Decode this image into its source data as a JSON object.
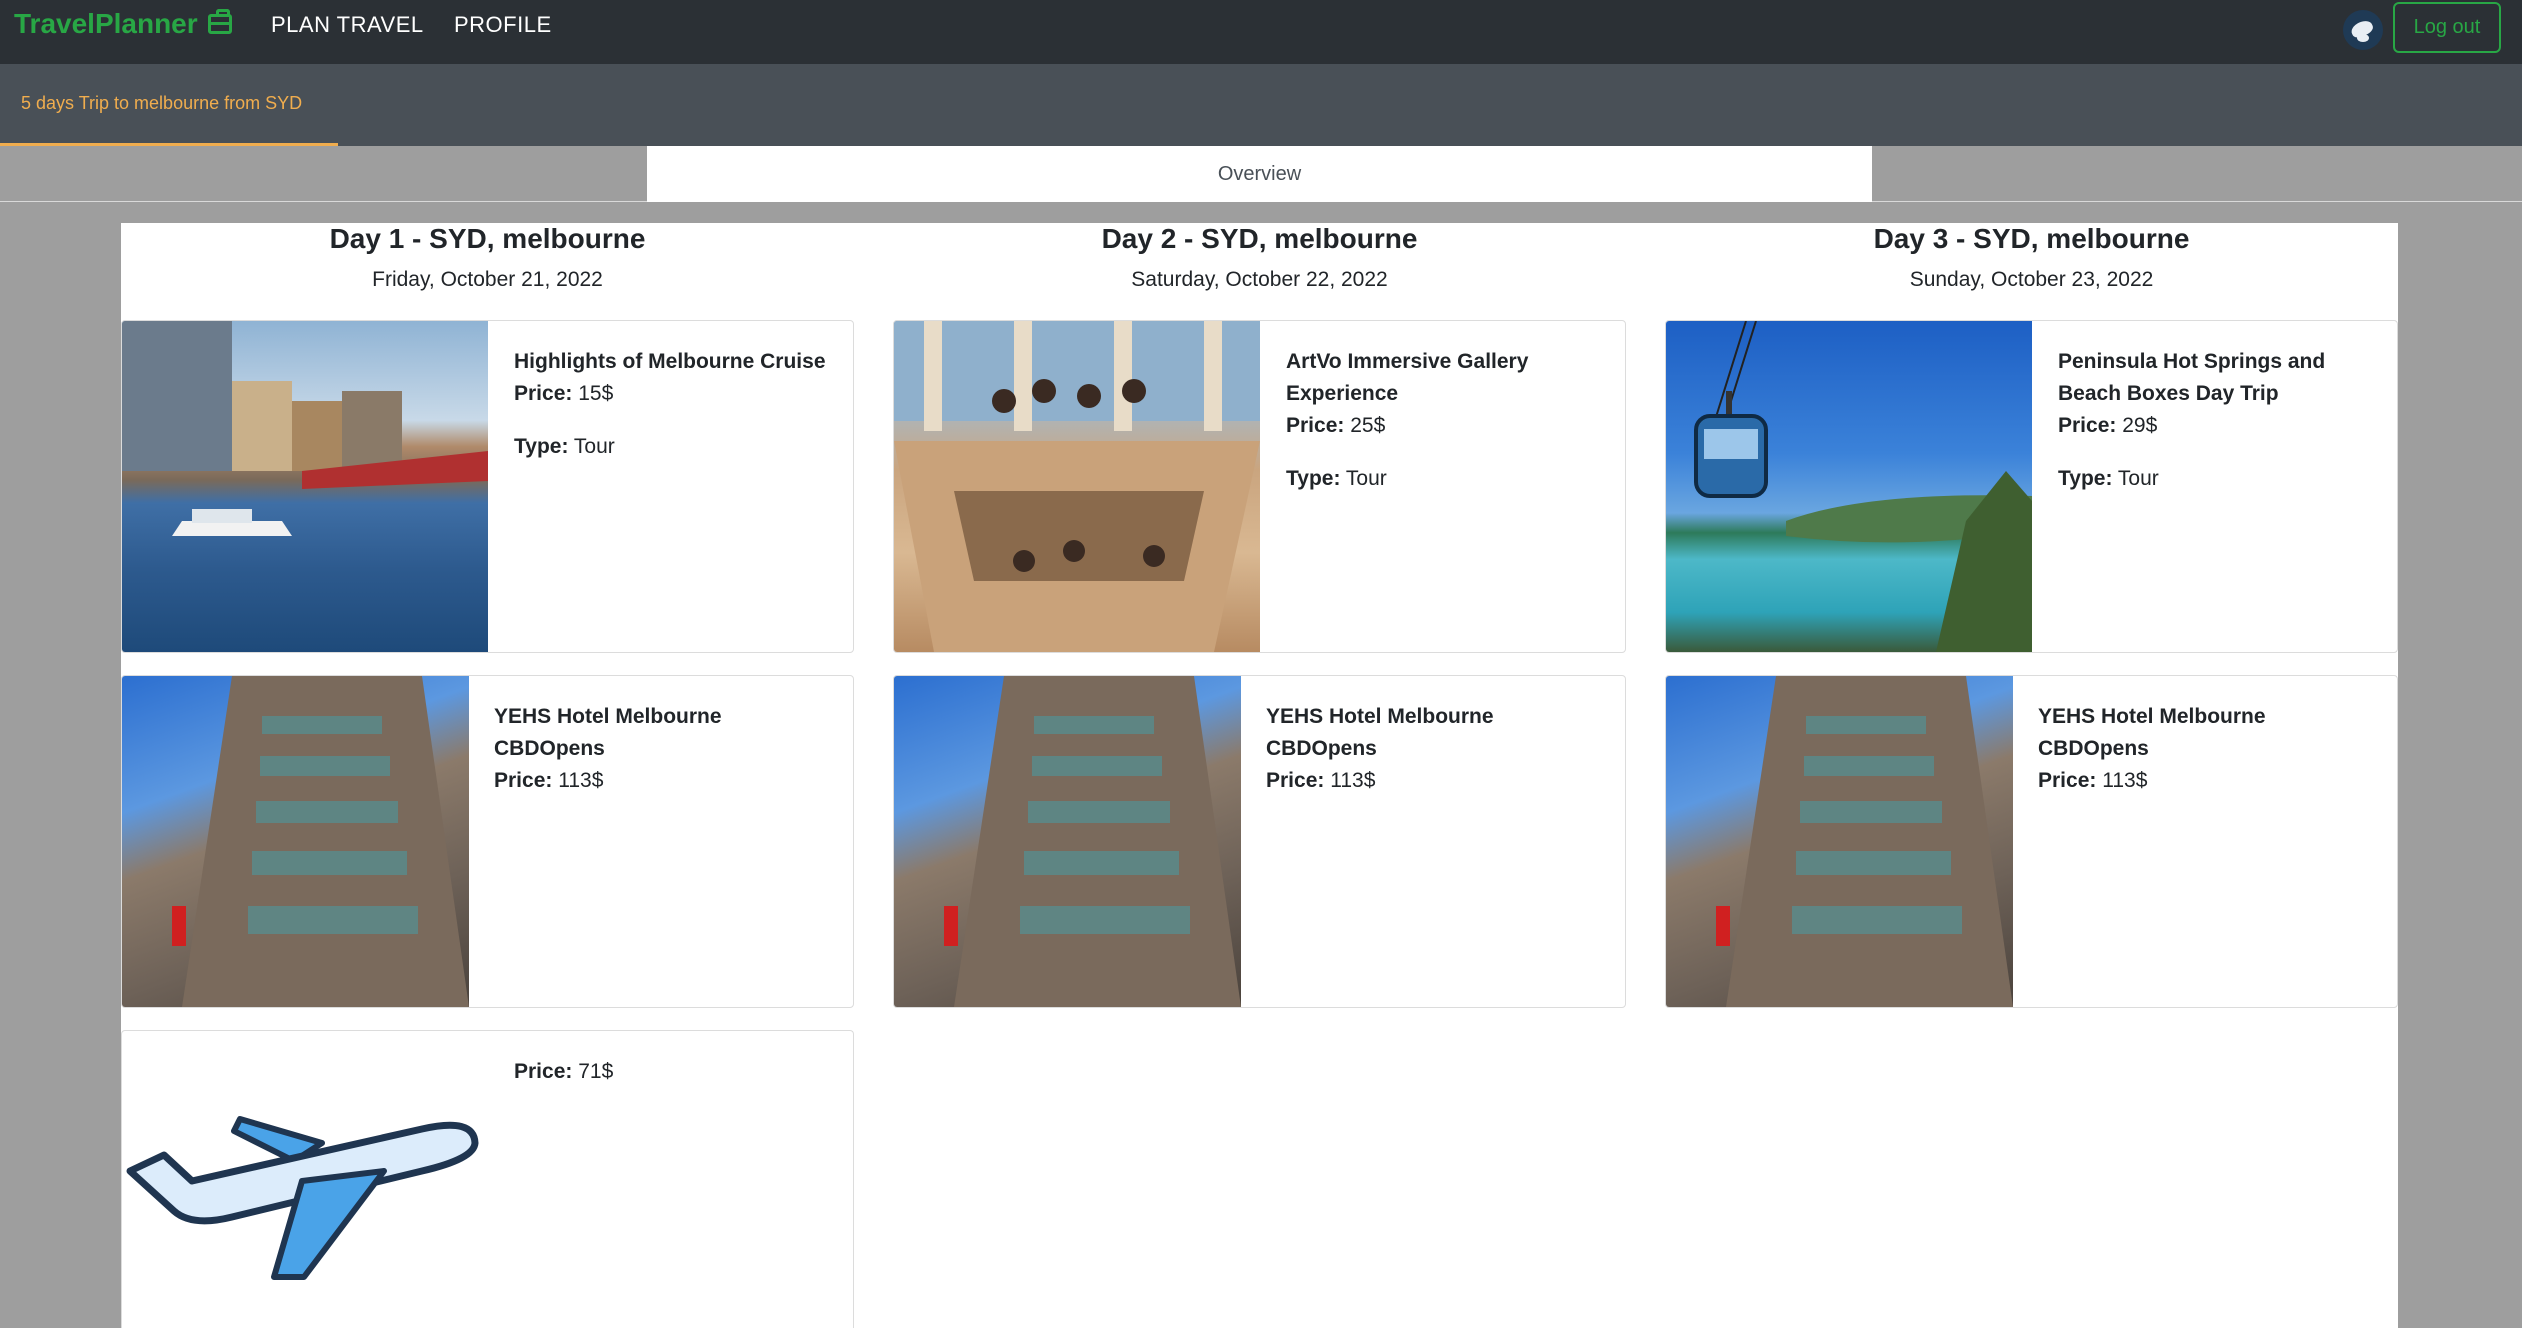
{
  "navbar": {
    "brand": "TravelPlanner",
    "links": [
      "PLAN TRAVEL",
      "PROFILE"
    ],
    "logout_label": "Log out"
  },
  "tabs": {
    "trip_tab": "5 days Trip to melbourne from SYD",
    "overview": "Overview"
  },
  "labels": {
    "price": "Price:",
    "type": "Type:"
  },
  "days": [
    {
      "title": "Day 1 - SYD, melbourne",
      "date": "Friday, October 21, 2022",
      "activity": {
        "name": "Highlights of Melbourne Cruise",
        "price": "15$",
        "type": "Tour"
      },
      "hotel": {
        "name": "YEHS Hotel Melbourne CBDOpens",
        "price": "113$"
      },
      "flight": {
        "price": "71$"
      }
    },
    {
      "title": "Day 2 - SYD, melbourne",
      "date": "Saturday, October 22, 2022",
      "activity": {
        "name": "ArtVo Immersive Gallery Experience",
        "price": "25$",
        "type": "Tour"
      },
      "hotel": {
        "name": "YEHS Hotel Melbourne CBDOpens",
        "price": "113$"
      }
    },
    {
      "title": "Day 3 - SYD, melbourne",
      "date": "Sunday, October 23, 2022",
      "activity": {
        "name": "Peninsula Hot Springs and Beach Boxes Day Trip",
        "price": "29$",
        "type": "Tour"
      },
      "hotel": {
        "name": "YEHS Hotel Melbourne CBDOpens",
        "price": "113$"
      }
    }
  ],
  "colors": {
    "brand": "#28a745",
    "accent": "#f0ad4e",
    "navbar": "#2b3035",
    "tabbar": "#495057"
  },
  "icons": [
    "briefcase-icon",
    "user-avatar",
    "airplane-icon"
  ]
}
